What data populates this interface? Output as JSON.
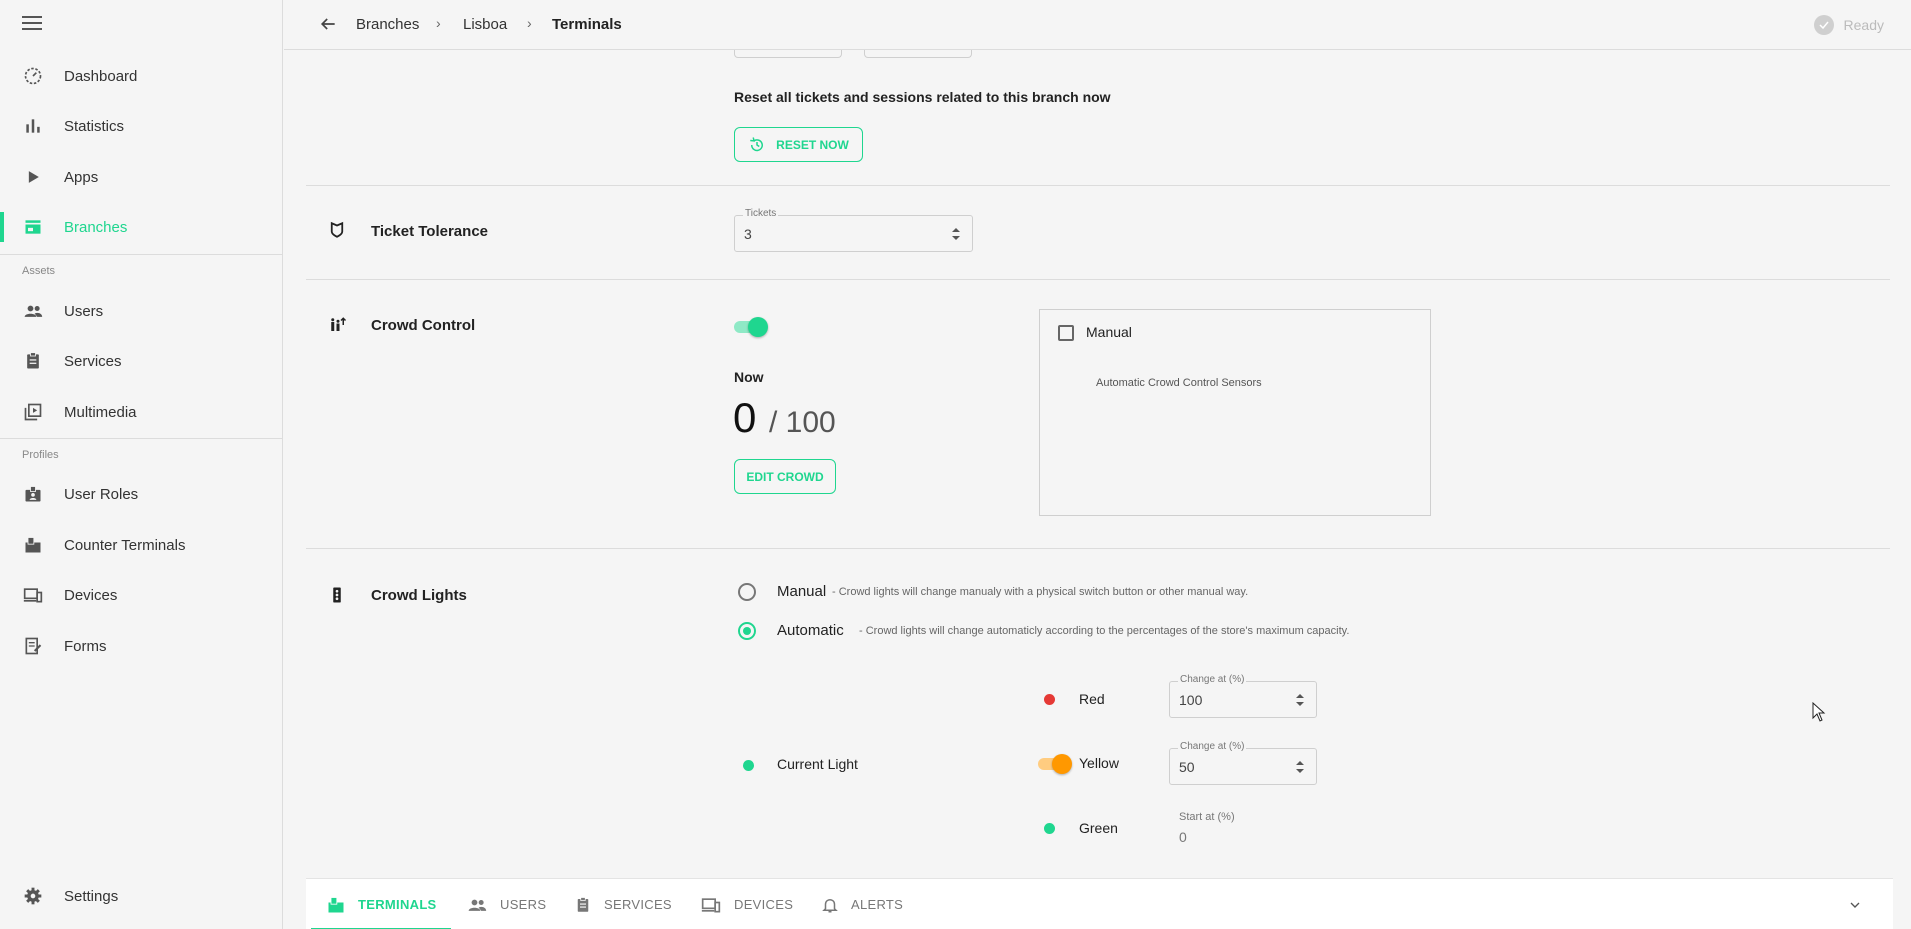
{
  "sidebar": {
    "items": [
      {
        "label": "Dashboard",
        "icon": "dashboard-icon"
      },
      {
        "label": "Statistics",
        "icon": "bar-chart-icon"
      },
      {
        "label": "Apps",
        "icon": "play-icon"
      },
      {
        "label": "Branches",
        "icon": "store-icon",
        "active": true
      },
      {
        "label": "Users",
        "icon": "users-icon"
      },
      {
        "label": "Services",
        "icon": "clipboard-icon"
      },
      {
        "label": "Multimedia",
        "icon": "video-library-icon"
      },
      {
        "label": "User Roles",
        "icon": "badge-icon"
      },
      {
        "label": "Counter Terminals",
        "icon": "terminal-icon"
      },
      {
        "label": "Devices",
        "icon": "devices-icon"
      },
      {
        "label": "Forms",
        "icon": "form-icon"
      }
    ],
    "sections": {
      "assets": "Assets",
      "profiles": "Profiles"
    },
    "settings_label": "Settings"
  },
  "header": {
    "breadcrumb": [
      "Branches",
      "Lisboa",
      "Terminals"
    ],
    "status": "Ready"
  },
  "reset": {
    "text": "Reset all tickets and sessions related to this branch now",
    "button": "RESET NOW"
  },
  "ticket_tolerance": {
    "title": "Ticket Tolerance",
    "field_label": "Tickets",
    "value": "3"
  },
  "crowd_control": {
    "title": "Crowd Control",
    "enabled": true,
    "now_label": "Now",
    "current": "0",
    "max": "/ 100",
    "edit_button": "EDIT CROWD",
    "manual_label": "Manual",
    "sensors_label": "Automatic Crowd Control Sensors"
  },
  "crowd_lights": {
    "title": "Crowd Lights",
    "manual_label": "Manual",
    "manual_desc": "- Crowd lights will change manualy with a physical switch button or other manual way.",
    "automatic_label": "Automatic",
    "automatic_desc": "- Crowd lights will change automaticly according to the percentages of the store's maximum capacity.",
    "selected": "Automatic",
    "current_light_label": "Current Light",
    "lights": {
      "red": {
        "label": "Red",
        "field_label": "Change at (%)",
        "value": "100",
        "color": "#e53935"
      },
      "yellow": {
        "label": "Yellow",
        "field_label": "Change at (%)",
        "value": "50",
        "color": "#ff9800"
      },
      "green": {
        "label": "Green",
        "field_label": "Start at (%)",
        "value": "0",
        "color": "#1fd68f"
      }
    }
  },
  "tabs": [
    {
      "label": "TERMINALS",
      "icon": "terminal-icon",
      "active": true
    },
    {
      "label": "USERS",
      "icon": "users-icon"
    },
    {
      "label": "SERVICES",
      "icon": "clipboard-icon"
    },
    {
      "label": "DEVICES",
      "icon": "devices-icon"
    },
    {
      "label": "ALERTS",
      "icon": "bell-icon"
    }
  ],
  "colors": {
    "accent": "#1fd68f",
    "red": "#e53935",
    "yellow": "#ff9800"
  }
}
